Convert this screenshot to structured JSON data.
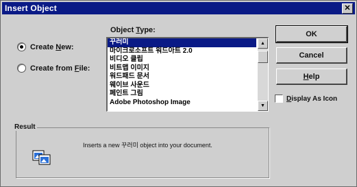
{
  "dialog": {
    "title": "Insert Object",
    "close_glyph": "✕"
  },
  "radios": {
    "create_new": {
      "label_pre": "Create ",
      "label_key": "N",
      "label_post": "ew:",
      "checked": true
    },
    "create_from_file": {
      "label_pre": "Create from ",
      "label_key": "F",
      "label_post": "ile:",
      "checked": false
    }
  },
  "object_type": {
    "label_pre": "Object ",
    "label_key": "T",
    "label_post": "ype:",
    "items": [
      "꾸러미",
      "마이크로소프트 워드아트 2.0",
      "비디오 클립",
      "비트맵 이미지",
      "워드패드 문서",
      "웨이브 사운드",
      "페인트 그림",
      "Adobe Photoshop Image"
    ],
    "selected_index": 0
  },
  "buttons": {
    "ok": "OK",
    "cancel": "Cancel",
    "help_key": "H",
    "help_post": "elp"
  },
  "display_as_icon": {
    "label_key": "D",
    "label_post": "isplay As Icon",
    "checked": false
  },
  "result": {
    "title": "Result",
    "text": "Inserts a new 꾸러미 object into your document."
  },
  "icons": {
    "close": "close-icon",
    "scroll_up": "arrow-up-icon",
    "scroll_down": "arrow-down-icon",
    "result": "insert-object-icon"
  },
  "colors": {
    "titlebar": "#0a1a86",
    "selection": "#0a1a86",
    "dialog_bg": "#cfcfcf"
  }
}
